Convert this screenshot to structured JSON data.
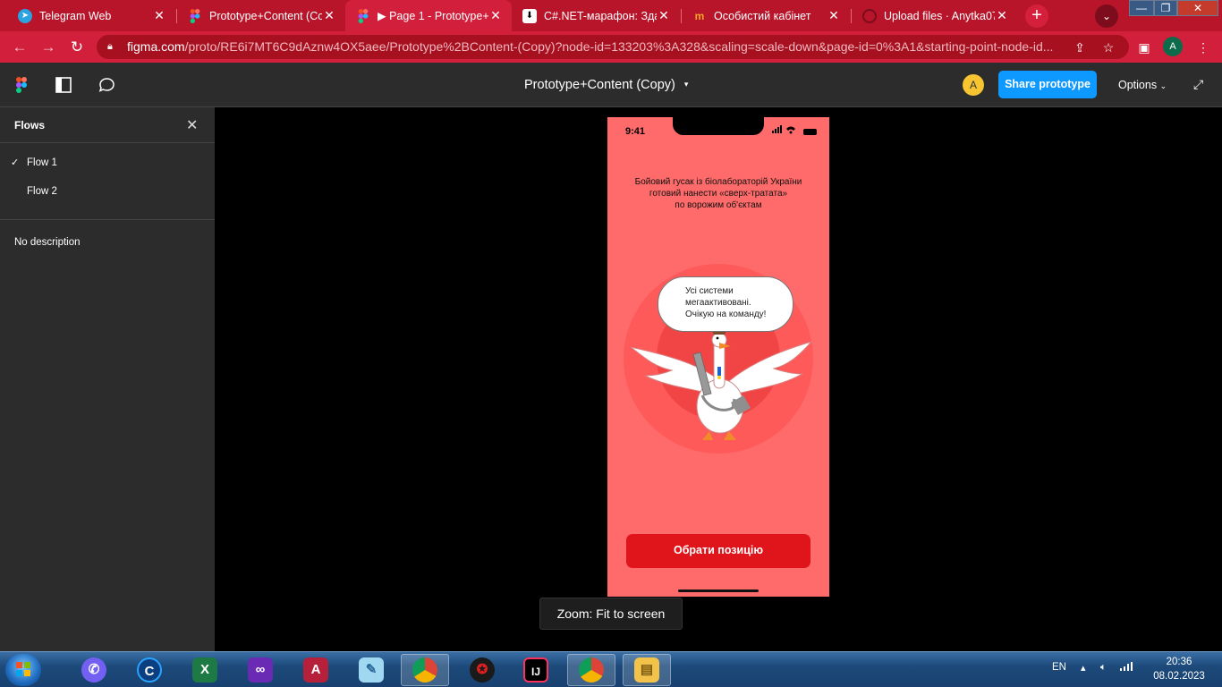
{
  "browser": {
    "tabs": [
      {
        "title": "Telegram Web",
        "icon": "telegram-icon",
        "active": false
      },
      {
        "title": "Prototype+Content (Co",
        "icon": "figma-icon",
        "active": false
      },
      {
        "title": "Page 1 - Prototype+",
        "icon": "figma-icon",
        "active": true
      },
      {
        "title": "C#.NET-марафон: Зда",
        "icon": "download-icon",
        "active": false
      },
      {
        "title": "Особистий кабінет",
        "icon": "m-logo-icon",
        "active": false
      },
      {
        "title": "Upload files · Anytka07/",
        "icon": "github-icon",
        "active": false
      }
    ],
    "tab_close": "✕",
    "new_tab": "+",
    "tab_search": "⌄",
    "window_controls": {
      "minimize": "—",
      "maximize": "❐",
      "close": "✕"
    },
    "url_host": "figma.com",
    "url_path": "/proto/RE6i7MT6C9dAznw4OX5aee/Prototype%2BContent-(Copy)?node-id=133203%3A328&scaling=scale-down&page-id=0%3A1&starting-point-node-id...",
    "profile_initial": "A"
  },
  "figma": {
    "doc_title": "Prototype+Content (Copy)",
    "user_initial": "A",
    "share_label": "Share prototype",
    "options_label": "Options",
    "sidebar": {
      "heading": "Flows",
      "flows": [
        "Flow 1",
        "Flow 2"
      ],
      "selected_flow": "Flow 1",
      "description": "No description"
    },
    "toast": "Zoom: Fit to screen"
  },
  "phone": {
    "time": "9:41",
    "headline_lines": [
      "Бойовий гусак із біолабораторій України",
      "готовий нанести «сверх-тратата»",
      "по ворожим об'єктам"
    ],
    "bubble_lines": [
      "Усі системи",
      "мегаактивовані.",
      "Очікую на команду!"
    ],
    "button": "Обрати позицію",
    "colors": {
      "background": "#ff6b6b",
      "button": "#e0151b"
    }
  },
  "taskbar": {
    "apps": [
      "viber-icon",
      "ccleaner-icon",
      "excel-icon",
      "visual-studio-icon",
      "access-icon",
      "notepad-icon",
      "chrome-icon",
      "game-icon",
      "intellij-icon",
      "chrome-profile-icon",
      "explorer-icon"
    ],
    "lang": "EN",
    "time": "20:36",
    "date": "08.02.2023"
  }
}
